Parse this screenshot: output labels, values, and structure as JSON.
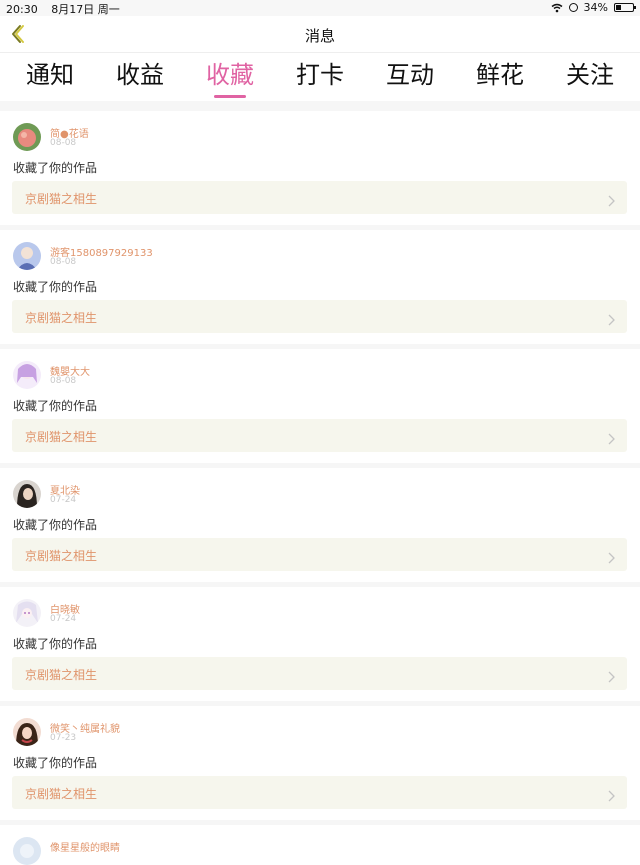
{
  "status_bar": {
    "time": "20:30",
    "date": "8月17日 周一",
    "battery": "34%",
    "battery_level": 0.34
  },
  "header": {
    "title": "消息"
  },
  "tabs": [
    {
      "label": "通知"
    },
    {
      "label": "收益"
    },
    {
      "label": "收藏",
      "active": true
    },
    {
      "label": "打卡"
    },
    {
      "label": "互动"
    },
    {
      "label": "鲜花"
    },
    {
      "label": "关注"
    }
  ],
  "items": [
    {
      "name": "简●花语",
      "date": "08-08",
      "action": "收藏了你的作品",
      "work": "京剧猫之相生"
    },
    {
      "name": "游客1580897929133",
      "date": "08-08",
      "action": "收藏了你的作品",
      "work": "京剧猫之相生"
    },
    {
      "name": "魏嬰大大",
      "date": "08-08",
      "action": "收藏了你的作品",
      "work": "京剧猫之相生"
    },
    {
      "name": "夏北染",
      "date": "07-24",
      "action": "收藏了你的作品",
      "work": "京剧猫之相生"
    },
    {
      "name": "白晓敏",
      "date": "07-24",
      "action": "收藏了你的作品",
      "work": "京剧猫之相生"
    },
    {
      "name": "微笑丶纯属礼貌",
      "date": "07-23",
      "action": "收藏了你的作品",
      "work": "京剧猫之相生"
    },
    {
      "name": "像星星般的眼睛"
    }
  ],
  "colors": {
    "accent": "#e063a3",
    "name": "#e0946b",
    "link_bg": "#f6f6ed"
  }
}
